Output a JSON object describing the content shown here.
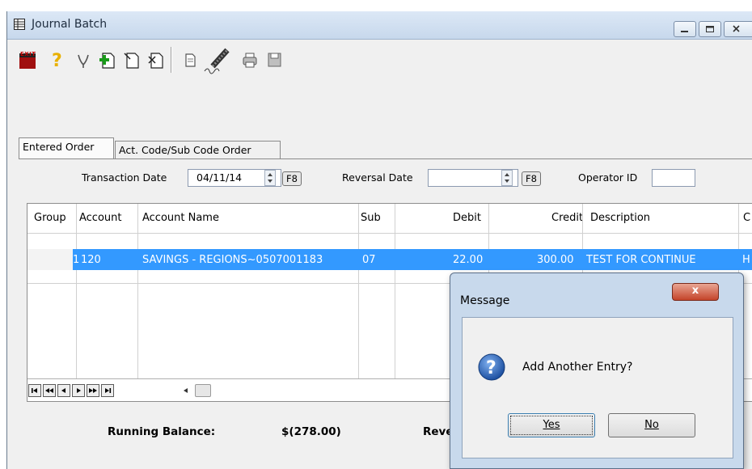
{
  "window": {
    "title": "Journal Batch"
  },
  "toolbar": {
    "exit_label": "EXIT",
    "buttons": [
      "exit-icon",
      "help-icon",
      "hand-icon",
      "add-document-icon",
      "edit-document-icon",
      "delete-document-icon",
      "page-icon",
      "pen-icon",
      "printer-icon",
      "save-icon"
    ]
  },
  "tabs": [
    "Entered Order",
    "Act. Code/Sub Code Order"
  ],
  "form": {
    "transaction_date_label": "Transaction Date",
    "transaction_date_value": "04/11/14",
    "f8": "F8",
    "reversal_date_label": "Reversal Date",
    "reversal_date_value": "",
    "operator_label": "Operator ID",
    "operator_value": ""
  },
  "grid": {
    "columns": [
      "Group",
      "Account",
      "Account Name",
      "Sub",
      "Debit",
      "Credit",
      "Description",
      "C"
    ],
    "rows": [
      {
        "group": "1",
        "account": "120",
        "account_name": "SAVINGS - REGIONS~0507001183",
        "sub": "07",
        "debit": "22.00",
        "credit": "300.00",
        "description": "TEST FOR CONTINUE",
        "c": "H"
      }
    ]
  },
  "summary": {
    "running_balance_label": "Running Balance:",
    "running_balance_value": "$(278.00)",
    "reversal_partial": "Reve"
  },
  "dialog": {
    "title": "Message",
    "close_label": "x",
    "message": "Add Another Entry?",
    "yes": "Yes",
    "no": "No"
  },
  "colors": {
    "selection": "#3399ff",
    "accent": "#2a5ea8"
  }
}
